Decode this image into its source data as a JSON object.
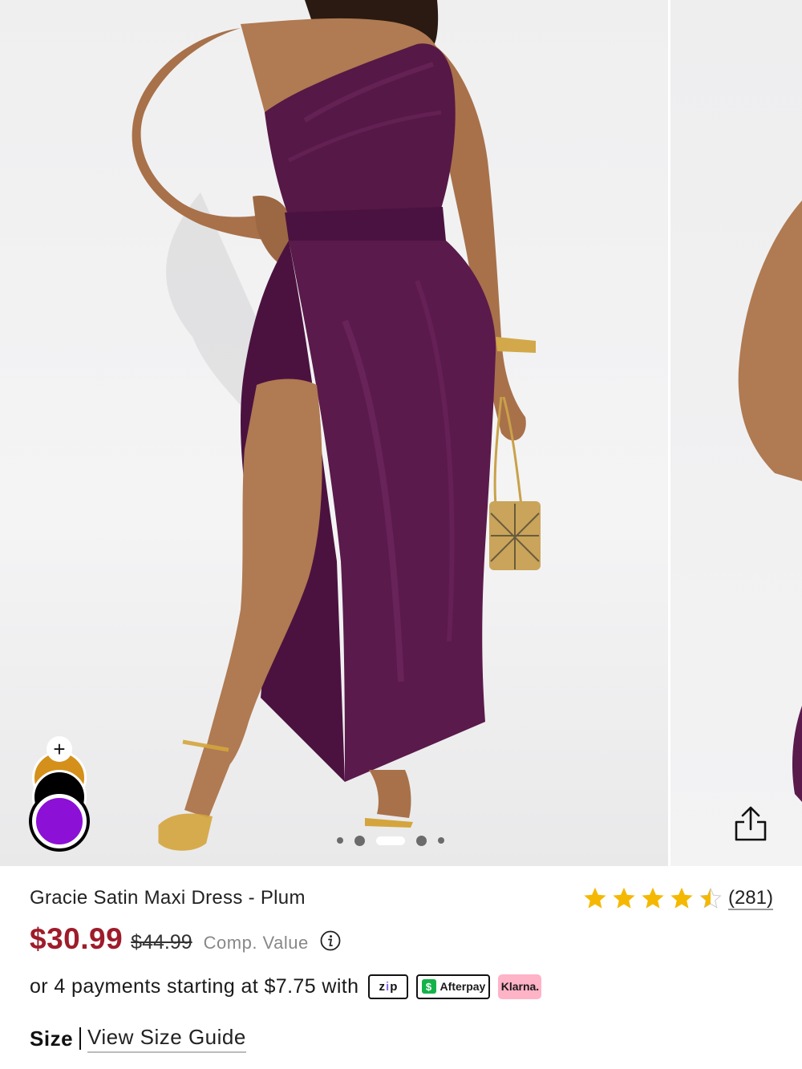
{
  "gallery": {
    "total_images": 5,
    "active_index": 2,
    "share_icon": "share-icon"
  },
  "swatches": {
    "add_label": "+",
    "colors": [
      {
        "name": "gold",
        "hex": "#d4901a"
      },
      {
        "name": "black",
        "hex": "#000000"
      },
      {
        "name": "plum",
        "hex": "#8d10d6",
        "selected": true
      }
    ]
  },
  "product": {
    "title": "Gracie Satin Maxi Dress - Plum",
    "rating": 4.5,
    "rating_max": 5,
    "review_count": "(281)",
    "sale_price": "$30.99",
    "original_price": "$44.99",
    "comp_value_label": "Comp. Value"
  },
  "payments": {
    "text": "or 4 payments starting at $7.75 with",
    "providers": [
      "zip",
      "Afterpay",
      "Klarna."
    ]
  },
  "size": {
    "label": "Size",
    "guide_link": "View Size Guide"
  },
  "colors": {
    "sale": "#9e1c2a",
    "star": "#f5b800",
    "plum": "#8d10d6"
  }
}
